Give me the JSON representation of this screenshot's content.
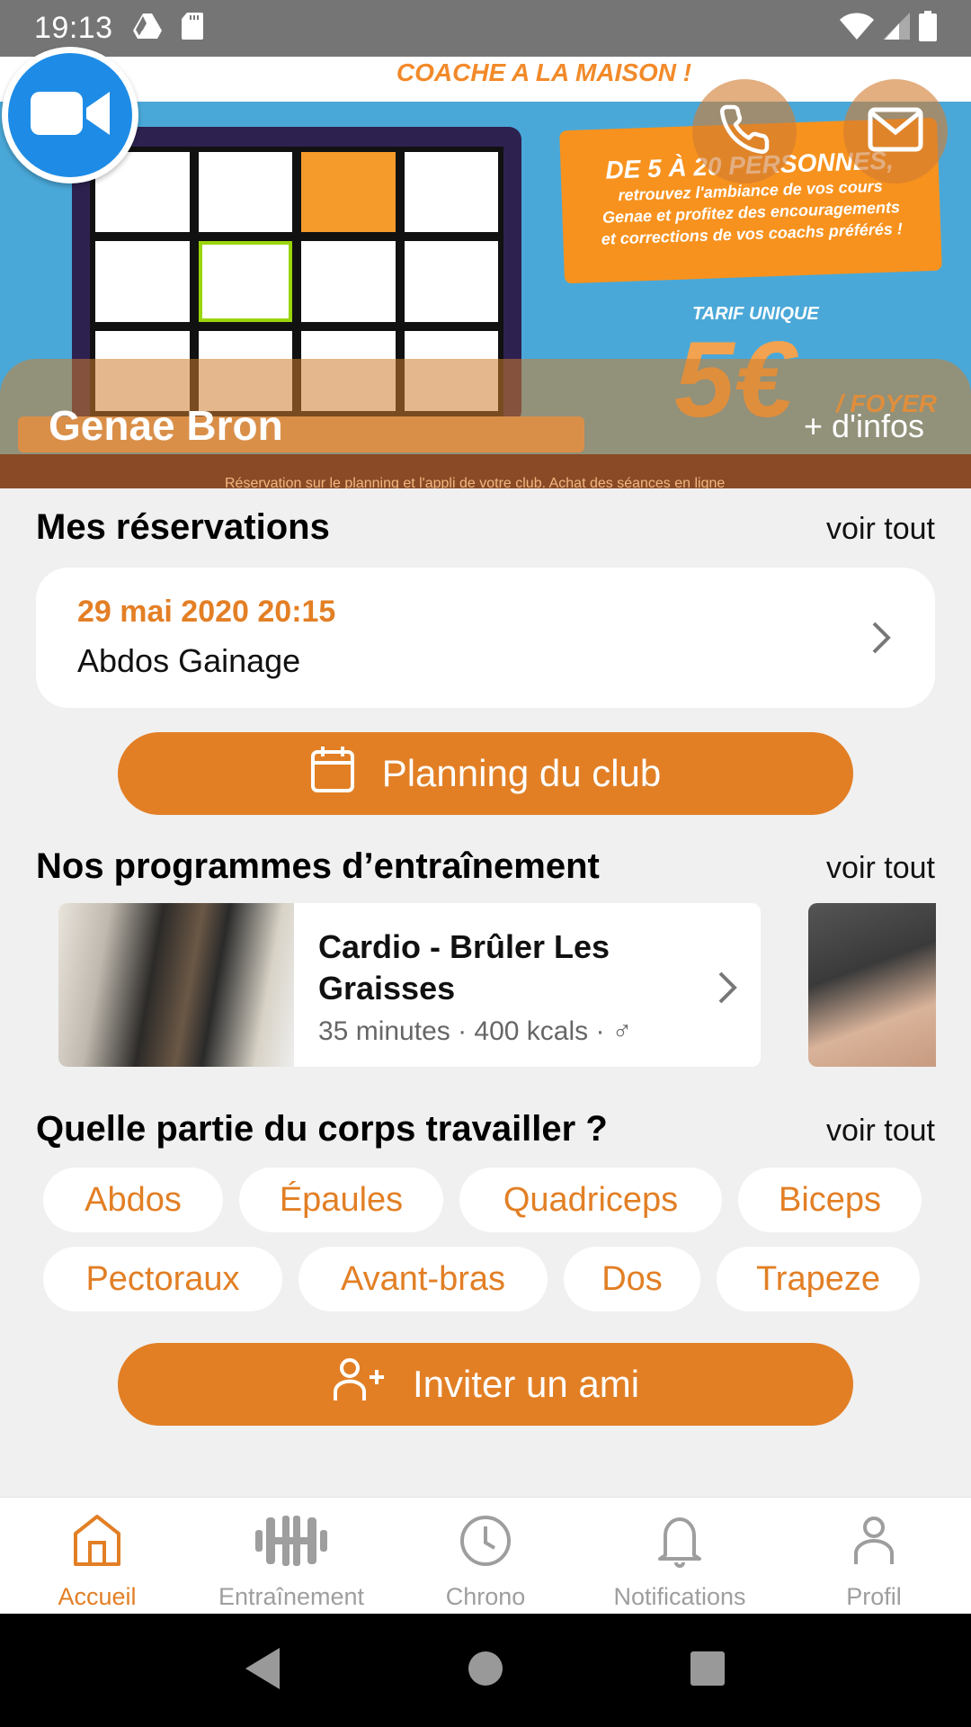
{
  "status_bar": {
    "time": "19:13",
    "left_icons": [
      "drive-icon",
      "sd-card-icon"
    ],
    "right_icons": [
      "wifi-icon",
      "signal-icon",
      "battery-icon"
    ]
  },
  "banner": {
    "headline": "COACHE A LA MAISON !",
    "promo_big": "DE 5 À 20 PERSONNES,",
    "promo_lines": [
      "retrouvez l'ambiance de vos cours",
      "Genae et profitez des encouragements",
      "et corrections de vos coachs préférés !"
    ],
    "tarif_label": "TARIF UNIQUE",
    "price": "5€",
    "price_unit": "/ FOYER",
    "bottom_strip": "Réservation sur le planning et l'appli de votre club. Achat des séances en ligne",
    "club_name": "Genae Bron",
    "more_info": "+ d'infos",
    "badge_icon": "video-camera-icon",
    "actions": [
      {
        "icon": "phone-icon",
        "label": "Appeler"
      },
      {
        "icon": "mail-icon",
        "label": "Email"
      }
    ]
  },
  "reservations": {
    "title": "Mes réservations",
    "see_all": "voir tout",
    "items": [
      {
        "date": "29 mai 2020 20:15",
        "name": "Abdos Gainage"
      }
    ]
  },
  "planning_button": {
    "label": "Planning du club",
    "icon": "calendar-icon"
  },
  "programs": {
    "title": "Nos programmes d’entraînement",
    "see_all": "voir tout",
    "items": [
      {
        "title": "Cardio - Brûler Les Graisses",
        "meta": "35 minutes · 400 kcals · ♂"
      }
    ]
  },
  "body_parts": {
    "title": "Quelle partie du corps travailler ?",
    "see_all": "voir tout",
    "chips": [
      "Abdos",
      "Épaules",
      "Quadriceps",
      "Biceps",
      "Pectoraux",
      "Avant-bras",
      "Dos",
      "Trapeze"
    ]
  },
  "invite_button": {
    "label": "Inviter un ami",
    "icon": "add-user-icon"
  },
  "tab_bar": {
    "active": "Accueil",
    "tabs": [
      {
        "label": "Accueil",
        "icon": "home-icon"
      },
      {
        "label": "Entraînement",
        "icon": "dumbbell-icon"
      },
      {
        "label": "Chrono",
        "icon": "clock-icon"
      },
      {
        "label": "Notifications",
        "icon": "bell-icon"
      },
      {
        "label": "Profil",
        "icon": "user-icon"
      }
    ]
  },
  "colors": {
    "accent": "#e27f25",
    "background": "#f0f0f0",
    "inactive": "#9e9e9e"
  }
}
